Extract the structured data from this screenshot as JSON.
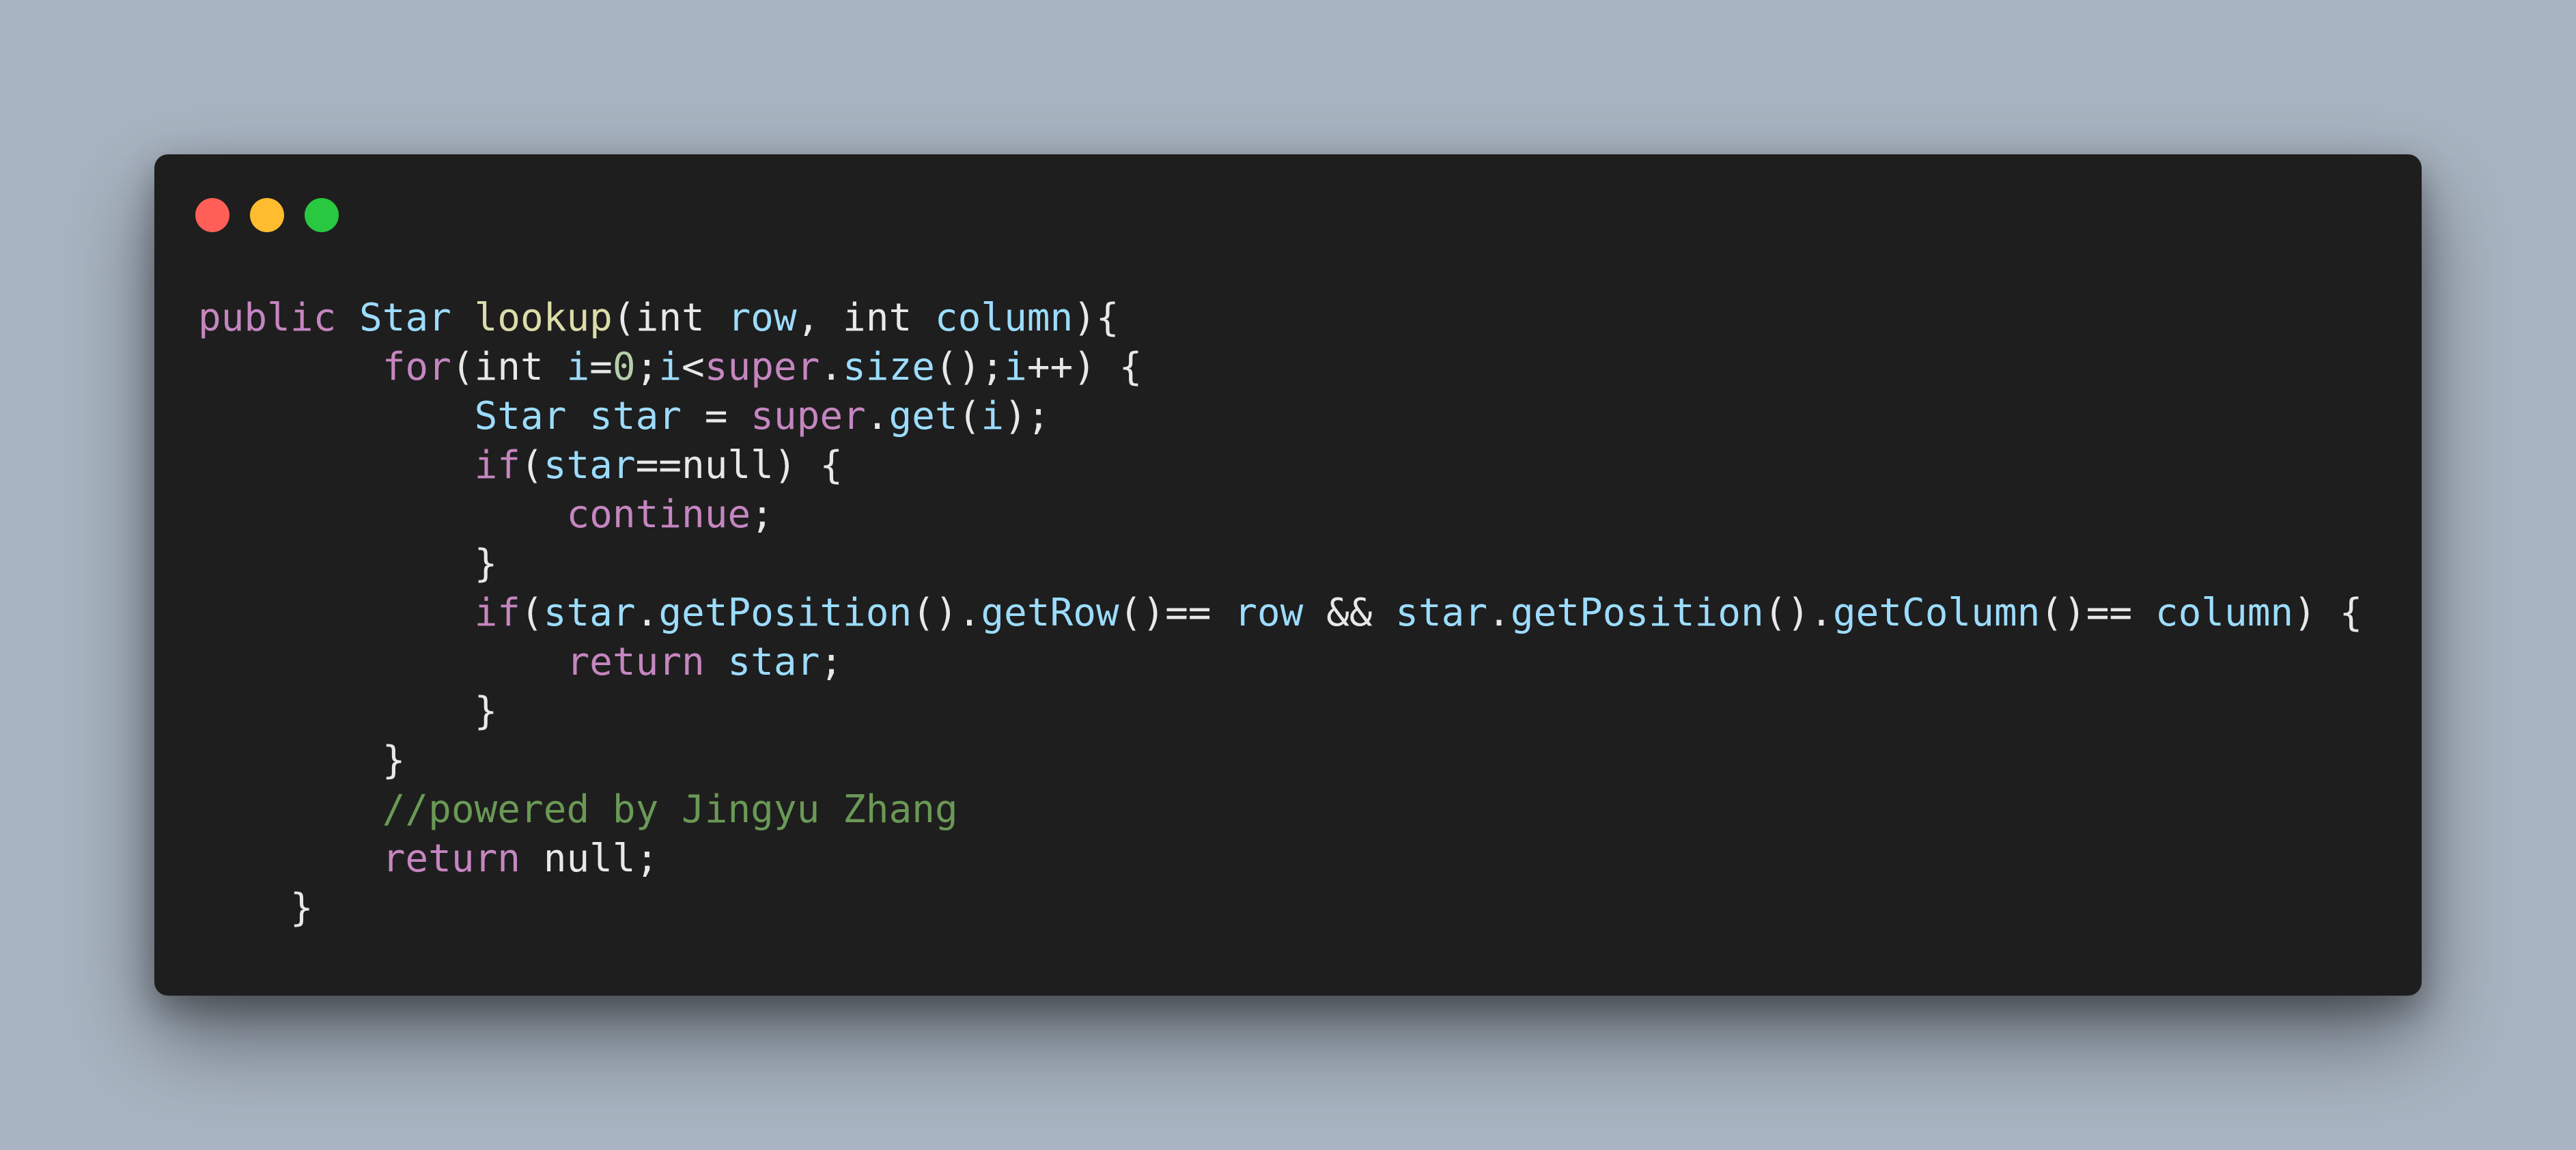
{
  "colors": {
    "background": "#a8b4c1",
    "window_background": "#1e1e1e",
    "close_button": "#ff5f57",
    "minimize_button": "#febc2e",
    "maximize_button": "#28c840",
    "default_text": "#e8e8e8",
    "keyword": "#c586c0",
    "type": "#9cdcfe",
    "function": "#dcdcaa",
    "number": "#b5cea8",
    "comment": "#6a9955"
  },
  "window_controls": [
    {
      "name": "close-button",
      "color": "#ff5f57"
    },
    {
      "name": "minimize-button",
      "color": "#febc2e"
    },
    {
      "name": "maximize-button",
      "color": "#28c840"
    }
  ],
  "code_lines": [
    [
      {
        "t": "public",
        "c": "keyword"
      },
      {
        "t": " ",
        "c": "default"
      },
      {
        "t": "Star",
        "c": "type"
      },
      {
        "t": " ",
        "c": "default"
      },
      {
        "t": "lookup",
        "c": "function"
      },
      {
        "t": "(int ",
        "c": "default"
      },
      {
        "t": "row",
        "c": "type"
      },
      {
        "t": ", int ",
        "c": "default"
      },
      {
        "t": "column",
        "c": "type"
      },
      {
        "t": "){",
        "c": "default"
      }
    ],
    [
      {
        "t": "        ",
        "c": "default"
      },
      {
        "t": "for",
        "c": "keyword"
      },
      {
        "t": "(int ",
        "c": "default"
      },
      {
        "t": "i",
        "c": "type"
      },
      {
        "t": "=",
        "c": "default"
      },
      {
        "t": "0",
        "c": "number"
      },
      {
        "t": ";",
        "c": "default"
      },
      {
        "t": "i",
        "c": "type"
      },
      {
        "t": "<",
        "c": "default"
      },
      {
        "t": "super",
        "c": "keyword"
      },
      {
        "t": ".",
        "c": "default"
      },
      {
        "t": "size",
        "c": "type"
      },
      {
        "t": "();",
        "c": "default"
      },
      {
        "t": "i",
        "c": "type"
      },
      {
        "t": "++) {",
        "c": "default"
      }
    ],
    [
      {
        "t": "            ",
        "c": "default"
      },
      {
        "t": "Star",
        "c": "type"
      },
      {
        "t": " ",
        "c": "default"
      },
      {
        "t": "star",
        "c": "type"
      },
      {
        "t": " = ",
        "c": "default"
      },
      {
        "t": "super",
        "c": "keyword"
      },
      {
        "t": ".",
        "c": "default"
      },
      {
        "t": "get",
        "c": "type"
      },
      {
        "t": "(",
        "c": "default"
      },
      {
        "t": "i",
        "c": "type"
      },
      {
        "t": ");",
        "c": "default"
      }
    ],
    [
      {
        "t": "            ",
        "c": "default"
      },
      {
        "t": "if",
        "c": "keyword"
      },
      {
        "t": "(",
        "c": "default"
      },
      {
        "t": "star",
        "c": "type"
      },
      {
        "t": "==null) {",
        "c": "default"
      }
    ],
    [
      {
        "t": "                ",
        "c": "default"
      },
      {
        "t": "continue",
        "c": "keyword"
      },
      {
        "t": ";",
        "c": "default"
      }
    ],
    [
      {
        "t": "            }",
        "c": "default"
      }
    ],
    [
      {
        "t": "            ",
        "c": "default"
      },
      {
        "t": "if",
        "c": "keyword"
      },
      {
        "t": "(",
        "c": "default"
      },
      {
        "t": "star",
        "c": "type"
      },
      {
        "t": ".",
        "c": "default"
      },
      {
        "t": "getPosition",
        "c": "type"
      },
      {
        "t": "().",
        "c": "default"
      },
      {
        "t": "getRow",
        "c": "type"
      },
      {
        "t": "()== ",
        "c": "default"
      },
      {
        "t": "row",
        "c": "type"
      },
      {
        "t": " && ",
        "c": "default"
      },
      {
        "t": "star",
        "c": "type"
      },
      {
        "t": ".",
        "c": "default"
      },
      {
        "t": "getPosition",
        "c": "type"
      },
      {
        "t": "().",
        "c": "default"
      },
      {
        "t": "getColumn",
        "c": "type"
      },
      {
        "t": "()== ",
        "c": "default"
      },
      {
        "t": "column",
        "c": "type"
      },
      {
        "t": ") {",
        "c": "default"
      }
    ],
    [
      {
        "t": "                ",
        "c": "default"
      },
      {
        "t": "return",
        "c": "keyword"
      },
      {
        "t": " ",
        "c": "default"
      },
      {
        "t": "star",
        "c": "type"
      },
      {
        "t": ";",
        "c": "default"
      }
    ],
    [
      {
        "t": "            }",
        "c": "default"
      }
    ],
    [
      {
        "t": "        }",
        "c": "default"
      }
    ],
    [
      {
        "t": "        ",
        "c": "default"
      },
      {
        "t": "//powered by Jingyu Zhang",
        "c": "comment"
      }
    ],
    [
      {
        "t": "        ",
        "c": "default"
      },
      {
        "t": "return",
        "c": "keyword"
      },
      {
        "t": " null;",
        "c": "default"
      }
    ],
    [
      {
        "t": "    }",
        "c": "default"
      }
    ]
  ]
}
